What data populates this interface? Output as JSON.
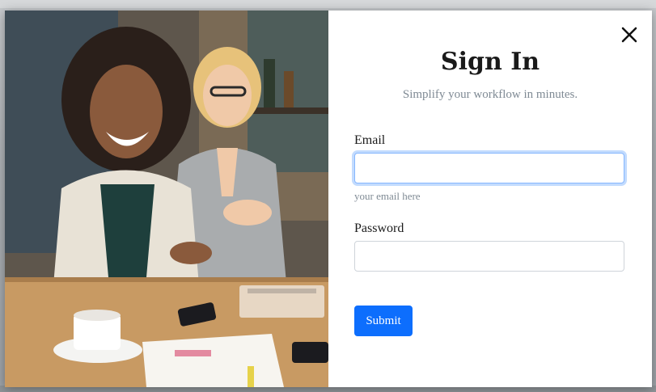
{
  "modal": {
    "title": "Sign In",
    "subtitle": "Simplify your workflow in minutes.",
    "close_icon": "close-icon",
    "hero_image": "two-women-laughing-at-table-photo"
  },
  "form": {
    "email": {
      "label": "Email",
      "value": "",
      "help": "your email here"
    },
    "password": {
      "label": "Password",
      "value": ""
    },
    "submit_label": "Submit"
  },
  "colors": {
    "accent": "#0d6efd",
    "focus_ring": "#86b7fe",
    "muted_text": "#7f8a94"
  }
}
